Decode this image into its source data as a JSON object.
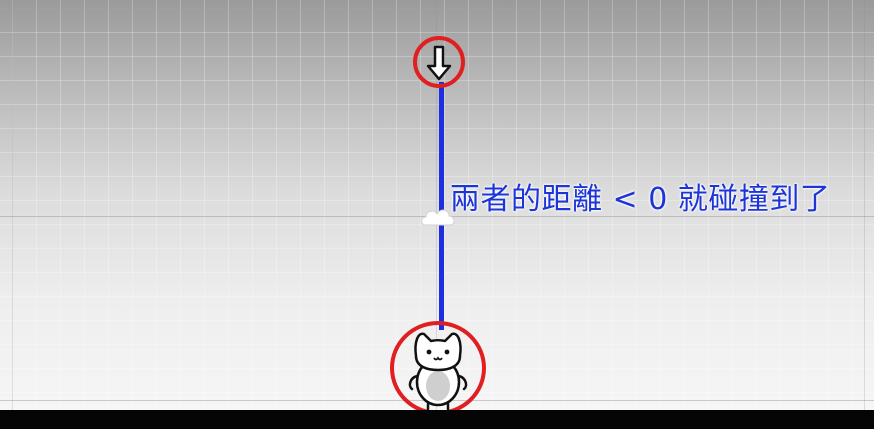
{
  "scene": {
    "caption": "兩者的距離 < 0 就碰撞到了",
    "colors": {
      "line": "#1d2fe0",
      "marker_ring": "#e02020",
      "caption": "#1d35d8",
      "ground": "#050505"
    },
    "icons": {
      "falling_object": "down-arrow-icon",
      "player": "cat-icon",
      "background_sprite": "cloud-icon"
    }
  }
}
